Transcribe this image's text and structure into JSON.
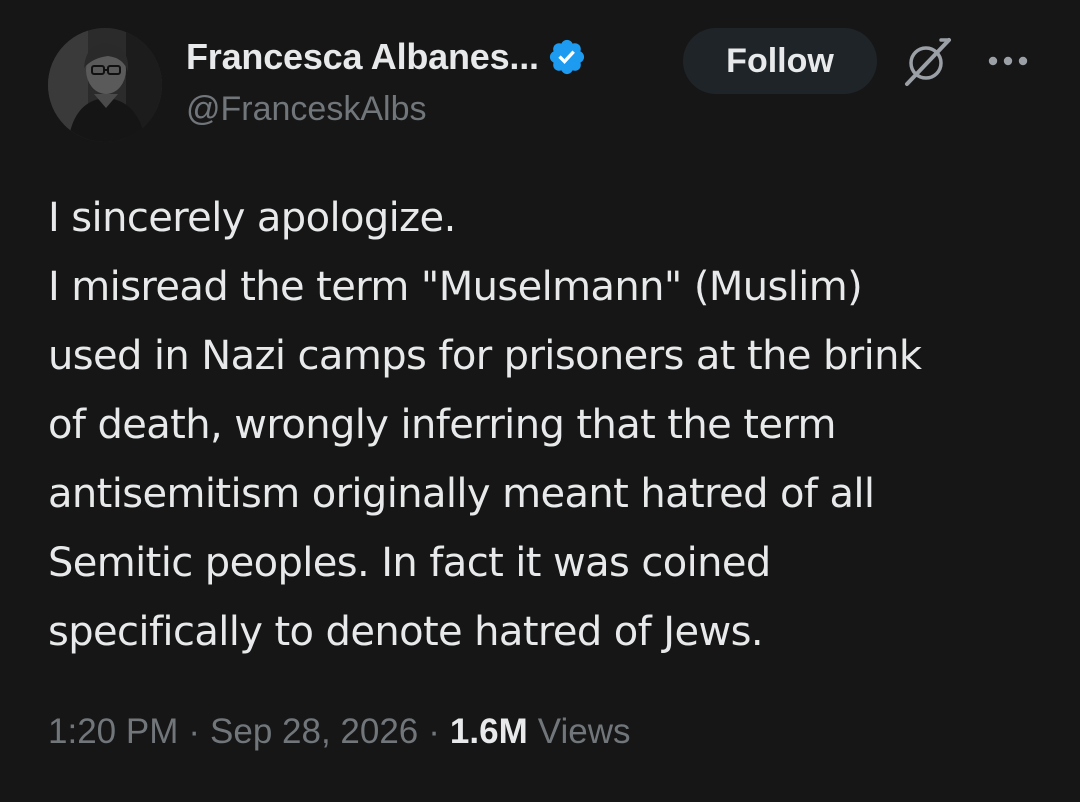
{
  "author": {
    "display_name": "Francesca Albanes...",
    "handle": "@FranceskAlbs",
    "verified": true,
    "verified_color": "#1d9bf0"
  },
  "actions": {
    "follow_label": "Follow",
    "grok_icon": "grok-icon",
    "more_icon": "more-horizontal-icon"
  },
  "tweet": {
    "lines": [
      "I sincerely apologize.",
      "I misread the term \"Muselmann\" (Muslim)",
      "used in Nazi camps for prisoners at the brink",
      "of death, wrongly inferring that the term",
      "antisemitism originally meant hatred of all",
      "Semitic peoples. In fact it was coined",
      "specifically to denote hatred of Jews."
    ],
    "time": "1:20 PM",
    "date": "Sep 28, 2026",
    "separator": "·",
    "views_count": "1.6M",
    "views_label": "Views"
  },
  "colors": {
    "background": "#161616",
    "text": "#e7e9ea",
    "secondary": "#71767b",
    "follow_bg": "#1f2428"
  }
}
